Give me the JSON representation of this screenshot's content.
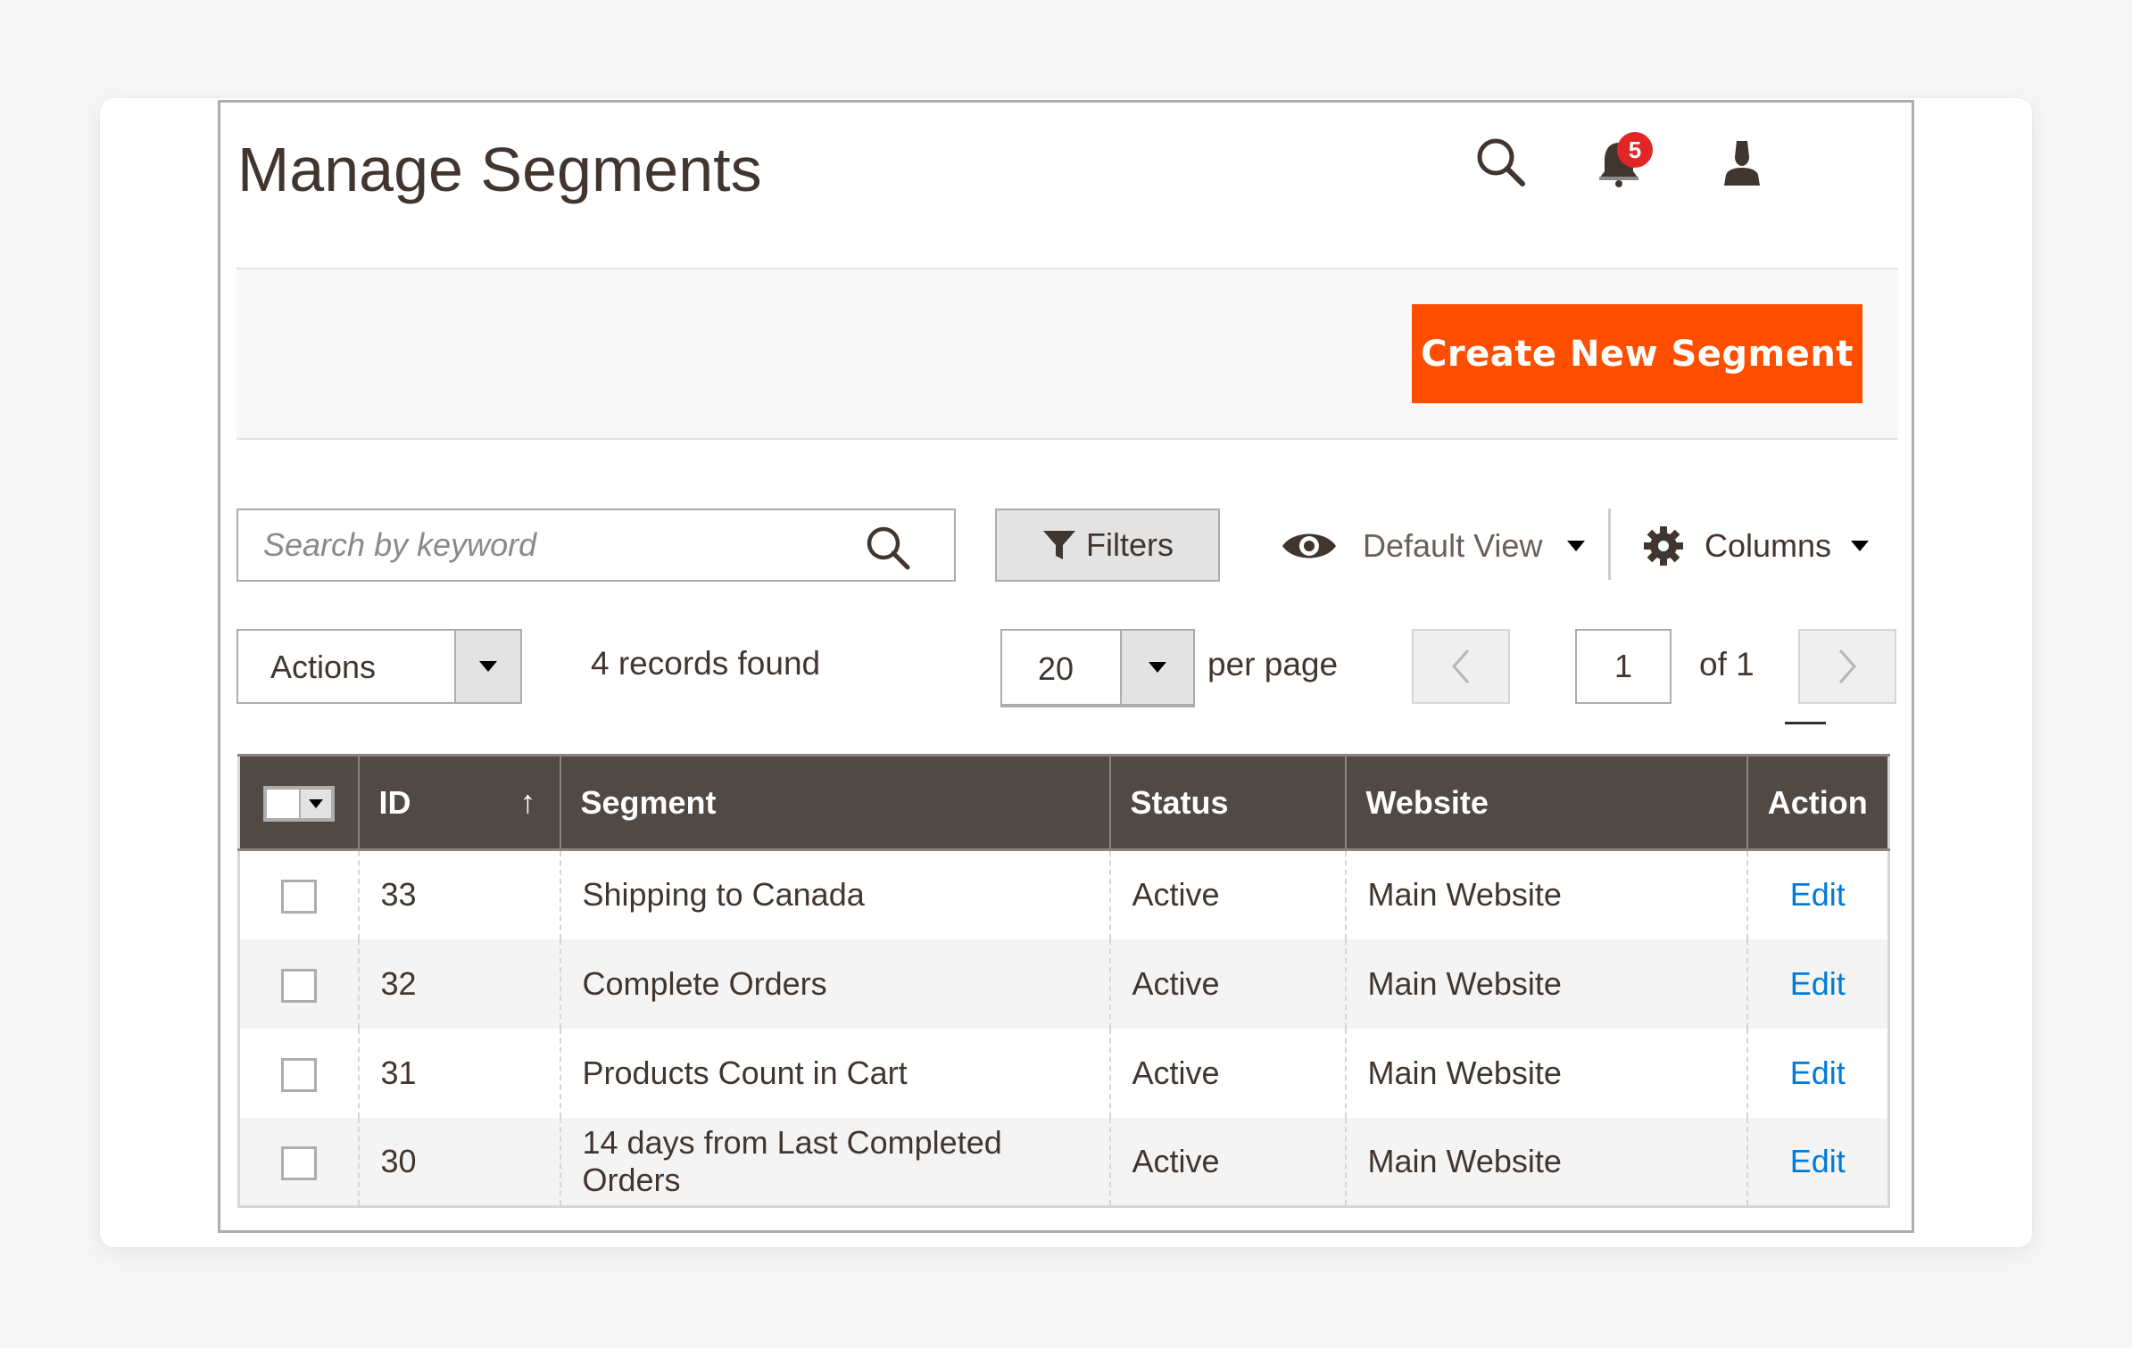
{
  "page": {
    "title": "Manage Segments"
  },
  "header": {
    "icons": [
      "search-icon",
      "bell-icon",
      "user-icon"
    ],
    "notification_count": "5"
  },
  "actions": {
    "create_button": "Create New Segment"
  },
  "toolbar": {
    "search_placeholder": "Search by keyword",
    "search_value": "",
    "filters_label": "Filters",
    "view_label": "Default View",
    "columns_label": "Columns",
    "mass_actions_label": "Actions",
    "records_found": "4 records found",
    "per_page_value": "20",
    "per_page_label": "per page",
    "current_page": "1",
    "total_pages_label": "of 1"
  },
  "grid": {
    "columns": [
      {
        "key": "select",
        "label": ""
      },
      {
        "key": "id",
        "label": "ID",
        "sort": "ascending"
      },
      {
        "key": "segment",
        "label": "Segment"
      },
      {
        "key": "status",
        "label": "Status"
      },
      {
        "key": "website",
        "label": "Website"
      },
      {
        "key": "action",
        "label": "Action"
      }
    ],
    "sort_indicator": "↑",
    "rows": [
      {
        "id": "33",
        "segment": "Shipping to Canada",
        "status": "Active",
        "website": "Main Website",
        "action": "Edit",
        "checked": false
      },
      {
        "id": "32",
        "segment": "Complete Orders",
        "status": "Active",
        "website": "Main Website",
        "action": "Edit",
        "checked": false
      },
      {
        "id": "31",
        "segment": "Products Count in Cart",
        "status": "Active",
        "website": "Main Website",
        "action": "Edit",
        "checked": false
      },
      {
        "id": "30",
        "segment": "14 days from Last Completed Orders",
        "status": "Active",
        "website": "Main Website",
        "action": "Edit",
        "checked": false
      }
    ]
  },
  "colors": {
    "primary_button": "#ff4e00",
    "grid_header": "#514943",
    "link": "#007bdb",
    "badge": "#e22626",
    "text": "#41362f"
  }
}
